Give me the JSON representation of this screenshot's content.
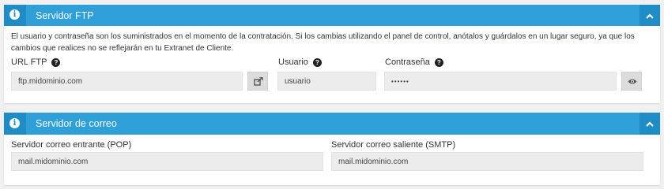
{
  "ftp_panel": {
    "title": "Servidor FTP",
    "description": "El usuario y contraseña son los suministrados en el momento de la contratación. Si los cambias utilizando el panel de control, anótalos y guárdalos en un lugar seguro, ya que los cambios que realices no se reflejarán en tu Extranet de Cliente.",
    "url_label": "URL FTP",
    "url_value": "ftp.midominio.com",
    "user_label": "Usuario",
    "user_value": "usuario",
    "password_label": "Contraseña",
    "password_value": "••••••",
    "icons": {
      "header": "info-icon",
      "collapse": "chevron-up-icon",
      "help": "question-circle-icon",
      "open_link": "external-link-icon",
      "show_password": "eye-icon"
    }
  },
  "mail_panel": {
    "title": "Servidor de correo",
    "pop_label": "Servidor correo entrante (POP)",
    "pop_value": "mail.midominio.com",
    "smtp_label": "Servidor correo saliente (SMTP)",
    "smtp_value": "mail.midominio.com",
    "icons": {
      "header": "info-icon",
      "collapse": "chevron-up-icon"
    }
  },
  "colors": {
    "header_bg": "#2f9fd8",
    "header_accent": "#1f8cc6",
    "input_bg": "#ececec",
    "page_bg": "#f1f1f1"
  }
}
